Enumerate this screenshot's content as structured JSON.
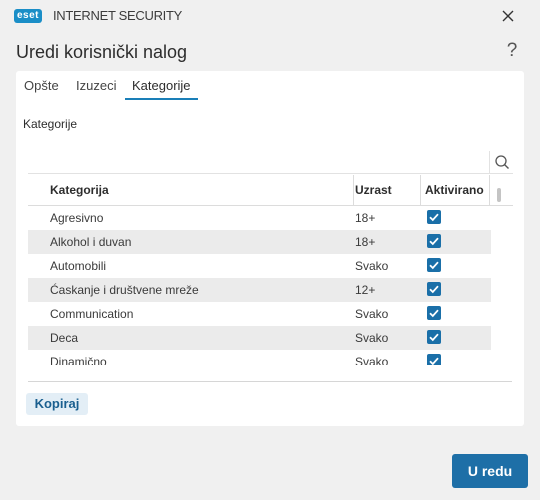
{
  "app": {
    "logo": "eset",
    "product": "INTERNET SECURITY"
  },
  "window": {
    "title": "Uredi korisnički nalog",
    "help_glyph": "?"
  },
  "tabs": [
    {
      "label": "Opšte",
      "active": false
    },
    {
      "label": "Izuzeci",
      "active": false
    },
    {
      "label": "Kategorije",
      "active": true
    }
  ],
  "section": {
    "label": "Kategorije"
  },
  "search": {
    "value": "",
    "placeholder": ""
  },
  "table": {
    "columns": [
      "Kategorija",
      "Uzrast",
      "Aktivirano"
    ],
    "rows": [
      {
        "category": "Agresivno",
        "age": "18+",
        "enabled": true
      },
      {
        "category": "Alkohol i duvan",
        "age": "18+",
        "enabled": true
      },
      {
        "category": "Automobili",
        "age": "Svako",
        "enabled": true
      },
      {
        "category": "Ćaskanje i društvene mreže",
        "age": "12+",
        "enabled": true
      },
      {
        "category": "Communication",
        "age": "Svako",
        "enabled": true
      },
      {
        "category": "Deca",
        "age": "Svako",
        "enabled": true
      },
      {
        "category": "Dinamično",
        "age": "Svako",
        "enabled": true
      }
    ]
  },
  "actions": {
    "copy_label": "Kopiraj",
    "primary_label": "U redu"
  },
  "colors": {
    "accent": "#1e6fa7",
    "checkbox": "#1a6fa8",
    "logo_bg": "#1a8ec7",
    "row_alt": "#ebebeb"
  },
  "icons": [
    "eset-logo",
    "close-icon",
    "help-icon",
    "search-icon",
    "checkmark-icon"
  ]
}
